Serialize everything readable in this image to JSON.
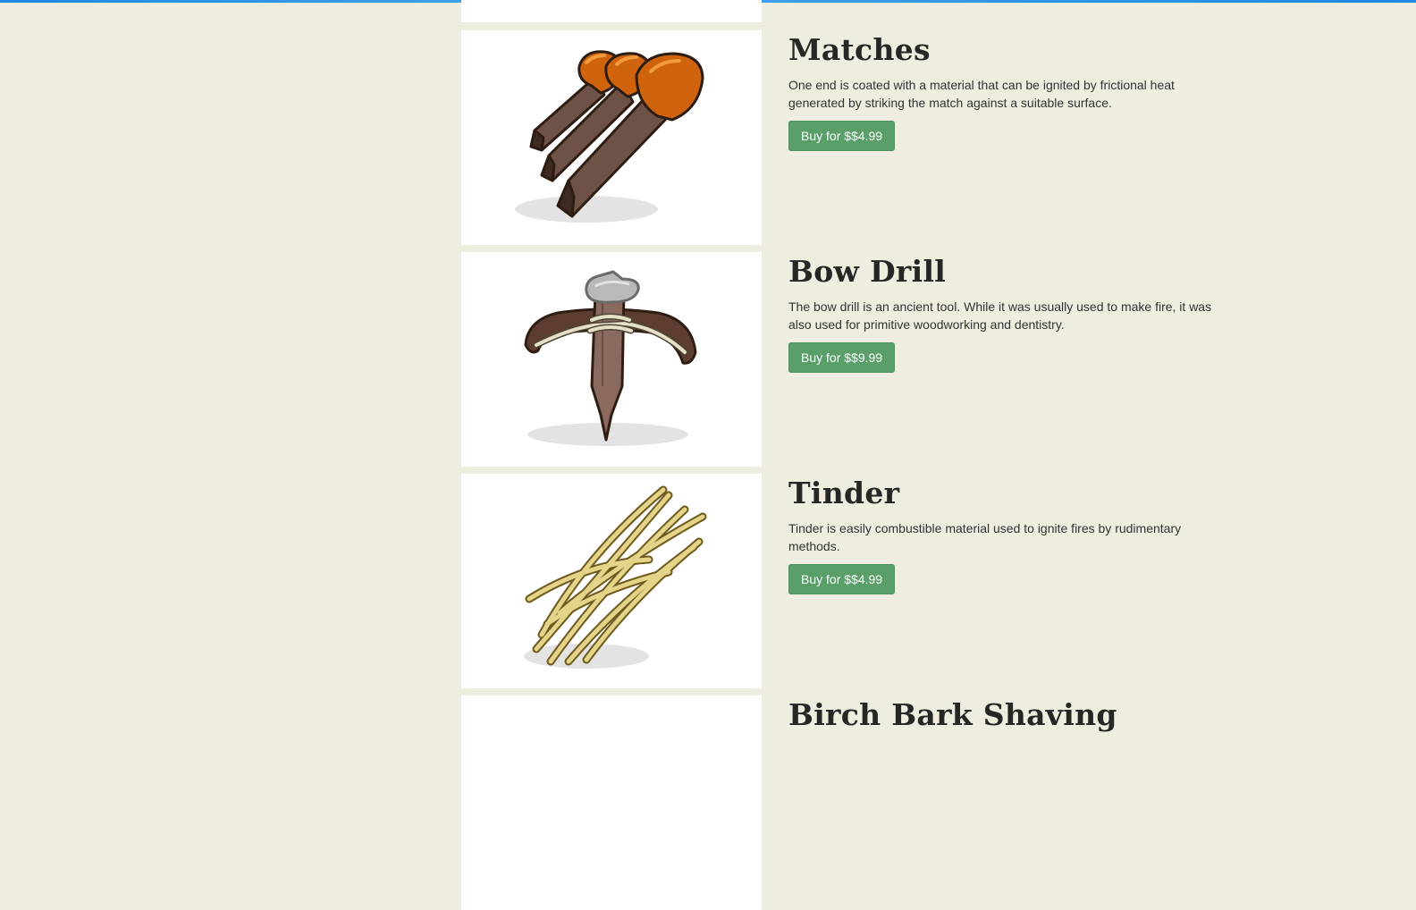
{
  "products": [
    {
      "name": "Matches",
      "description": "One end is coated with a material that can be ignited by frictional heat generated by striking the match against a suitable surface.",
      "buy_label": "Buy for $$4.99",
      "image_icon": "matches-icon"
    },
    {
      "name": "Bow Drill",
      "description": "The bow drill is an ancient tool. While it was usually used to make fire, it was also used for primitive woodworking and dentistry.",
      "buy_label": "Buy for $$9.99",
      "image_icon": "bow-drill-icon"
    },
    {
      "name": "Tinder",
      "description": "Tinder is easily combustible material used to ignite fires by rudimentary methods.",
      "buy_label": "Buy for $$4.99",
      "image_icon": "tinder-icon"
    },
    {
      "name": "Birch Bark Shaving",
      "image_icon": "birch-bark-icon"
    }
  ],
  "colors": {
    "page_background": "#efece0",
    "buy_button": "#5a9e6a",
    "progress_bar": "#1e88e5"
  }
}
